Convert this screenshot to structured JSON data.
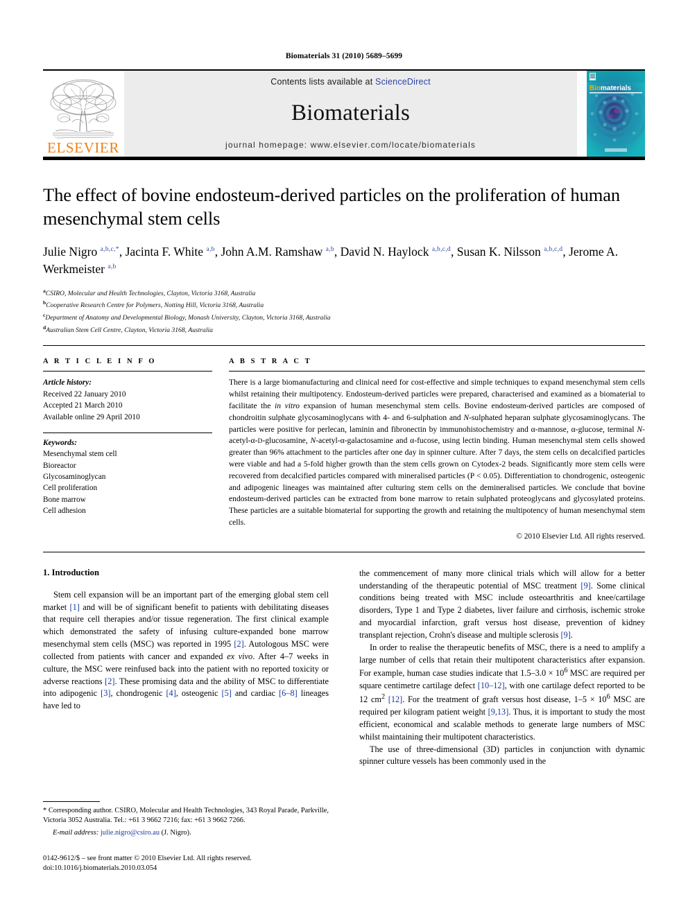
{
  "running_head": "Biomaterials 31 (2010) 5689–5699",
  "masthead": {
    "contents_prefix": "Contents lists available at ",
    "sciencedirect": "ScienceDirect",
    "journal_name": "Biomaterials",
    "homepage": "journal homepage: www.elsevier.com/locate/biomaterials",
    "publisher": "ELSEVIER",
    "cover_title_a": "Bio",
    "cover_title_b": "materials",
    "accent_orange": "#f07f12",
    "link_blue": "#2b45a6",
    "cover_teal": "#16a2b0"
  },
  "title": "The effect of bovine endosteum-derived particles on the proliferation of human mesenchymal stem cells",
  "authors": [
    {
      "name": "Julie Nigro",
      "marks": "a,b,c,*",
      "sep": ", "
    },
    {
      "name": "Jacinta F. White",
      "marks": "a,b",
      "sep": ", "
    },
    {
      "name": "John A.M. Ramshaw",
      "marks": "a,b",
      "sep": ", "
    },
    {
      "name": "David N. Haylock",
      "marks": "a,b,c,d",
      "sep": ", "
    },
    {
      "name": "Susan K. Nilsson",
      "marks": "a,b,c,d",
      "sep": ", "
    },
    {
      "name": "Jerome A. Werkmeister",
      "marks": "a,b",
      "sep": ""
    }
  ],
  "affiliations": [
    {
      "mark": "a",
      "text": "CSIRO, Molecular and Health Technologies, Clayton, Victoria 3168, Australia"
    },
    {
      "mark": "b",
      "text": "Cooperative Research Centre for Polymers, Notting Hill, Victoria 3168, Australia"
    },
    {
      "mark": "c",
      "text": "Department of Anatomy and Developmental Biology, Monash University, Clayton, Victoria 3168, Australia"
    },
    {
      "mark": "d",
      "text": "Australian Stem Cell Centre, Clayton, Victoria 3168, Australia"
    }
  ],
  "article_info": {
    "heading": "A R T I C L E   I N F O",
    "history_label": "Article history:",
    "history": [
      "Received 22 January 2010",
      "Accepted 21 March 2010",
      "Available online 29 April 2010"
    ],
    "keywords_label": "Keywords:",
    "keywords": [
      "Mesenchymal stem cell",
      "Bioreactor",
      "Glycosaminoglycan",
      "Cell proliferation",
      "Bone marrow",
      "Cell adhesion"
    ]
  },
  "abstract": {
    "heading": "A B S T R A C T",
    "copyright": "© 2010 Elsevier Ltd. All rights reserved."
  },
  "sections": {
    "intro_heading": "1.  Introduction"
  },
  "footnote": {
    "corresponding": "* Corresponding author. CSIRO, Molecular and Health Technologies, 343 Royal Parade, Parkville, Victoria 3052 Australia. Tel.: +61 3 9662 7216; fax: +61 3 9662 7266.",
    "email_label": "E-mail address:",
    "email": "julie.nigro@csiro.au",
    "email_suffix": "(J. Nigro).",
    "issn_line": "0142-9612/$ – see front matter © 2010 Elsevier Ltd. All rights reserved.",
    "doi_line": "doi:10.1016/j.biomaterials.2010.03.054"
  }
}
